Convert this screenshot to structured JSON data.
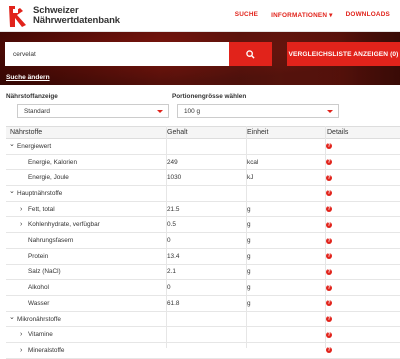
{
  "header": {
    "brand_line1": "Schweizer",
    "brand_line2": "Nährwertdatenbank",
    "nav": [
      "SUCHE",
      "INFORMATIONEN ▾",
      "DOWNLOADS"
    ]
  },
  "search": {
    "value": "cervelat",
    "compare_button": "VERGLEICHSLISTE ANZEIGEN (0)",
    "change_link": "Suche ändern"
  },
  "filters": {
    "display_label": "Nährstoffanzeige",
    "display_value": "Standard",
    "portion_label": "Portionengrösse wählen",
    "portion_value": "100 g"
  },
  "table": {
    "headers": [
      "Nährstoffe",
      "Gehalt",
      "Einheit",
      "Details"
    ],
    "rows": [
      {
        "name": "Energiewert",
        "value": "",
        "unit": "",
        "level": 0,
        "chevron": "down",
        "details": true
      },
      {
        "name": "Energie, Kalorien",
        "value": "249",
        "unit": "kcal",
        "level": 1,
        "chevron": "",
        "details": true
      },
      {
        "name": "Energie, Joule",
        "value": "1030",
        "unit": "kJ",
        "level": 1,
        "chevron": "",
        "details": true
      },
      {
        "name": "Hauptnährstoffe",
        "value": "",
        "unit": "",
        "level": 0,
        "chevron": "down",
        "details": true
      },
      {
        "name": "Fett, total",
        "value": "21.5",
        "unit": "g",
        "level": 1,
        "chevron": "right",
        "details": true
      },
      {
        "name": "Kohlenhydrate, verfügbar",
        "value": "0.5",
        "unit": "g",
        "level": 1,
        "chevron": "right",
        "details": true
      },
      {
        "name": "Nahrungsfasern",
        "value": "0",
        "unit": "g",
        "level": 1,
        "chevron": "",
        "details": true
      },
      {
        "name": "Protein",
        "value": "13.4",
        "unit": "g",
        "level": 1,
        "chevron": "",
        "details": true
      },
      {
        "name": "Salz (NaCl)",
        "value": "2.1",
        "unit": "g",
        "level": 1,
        "chevron": "",
        "details": true
      },
      {
        "name": "Alkohol",
        "value": "0",
        "unit": "g",
        "level": 1,
        "chevron": "",
        "details": true
      },
      {
        "name": "Wasser",
        "value": "61.8",
        "unit": "g",
        "level": 1,
        "chevron": "",
        "details": true
      },
      {
        "name": "Mikronährstoffe",
        "value": "",
        "unit": "",
        "level": 0,
        "chevron": "down",
        "details": true
      },
      {
        "name": "Vitamine",
        "value": "",
        "unit": "",
        "level": 1,
        "chevron": "right",
        "details": true
      },
      {
        "name": "Mineralstoffe",
        "value": "",
        "unit": "",
        "level": 1,
        "chevron": "right",
        "details": true
      }
    ]
  },
  "colors": {
    "accent": "#e1231b"
  }
}
